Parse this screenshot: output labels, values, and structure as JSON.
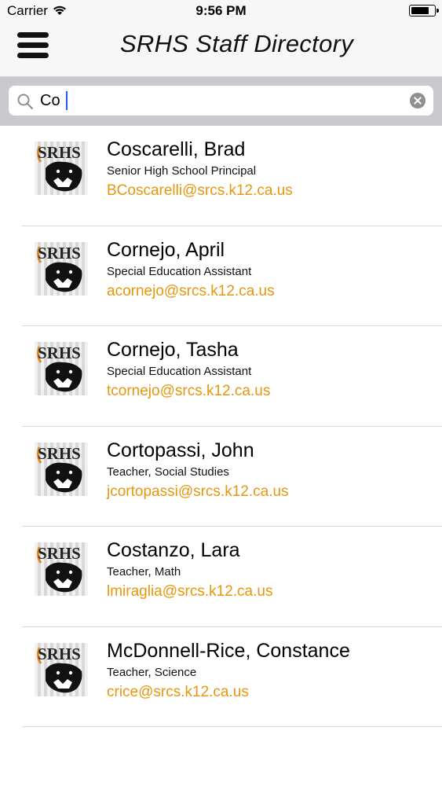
{
  "status_bar": {
    "carrier": "Carrier",
    "time": "9:56 PM"
  },
  "header": {
    "title": "SRHS Staff Directory"
  },
  "search": {
    "value": "Co",
    "placeholder": ""
  },
  "staff": [
    {
      "name": "Coscarelli, Brad",
      "title": "Senior High School Principal",
      "email": "BCoscarelli@srcs.k12.ca.us",
      "logo": "SRHS"
    },
    {
      "name": "Cornejo, April",
      "title": "Special Education Assistant",
      "email": "acornejo@srcs.k12.ca.us",
      "logo": "SRHS"
    },
    {
      "name": "Cornejo, Tasha",
      "title": "Special Education Assistant",
      "email": "tcornejo@srcs.k12.ca.us",
      "logo": "SRHS"
    },
    {
      "name": "Cortopassi, John",
      "title": "Teacher, Social Studies",
      "email": "jcortopassi@srcs.k12.ca.us",
      "logo": "SRHS"
    },
    {
      "name": "Costanzo, Lara",
      "title": "Teacher, Math",
      "email": "lmiraglia@srcs.k12.ca.us",
      "logo": "SRHS"
    },
    {
      "name": "McDonnell-Rice, Constance",
      "title": "Teacher, Science",
      "email": "crice@srcs.k12.ca.us",
      "logo": "SRHS"
    }
  ],
  "colors": {
    "email": "#e8960c",
    "search_bar": "#c9c9ce",
    "header": "#f7f7f7"
  },
  "icons": {
    "menu": "hamburger-menu-icon",
    "search": "magnifier-icon",
    "clear": "clear-x-icon",
    "wifi": "wifi-icon",
    "battery": "battery-icon",
    "avatar": "panther-logo-icon"
  }
}
